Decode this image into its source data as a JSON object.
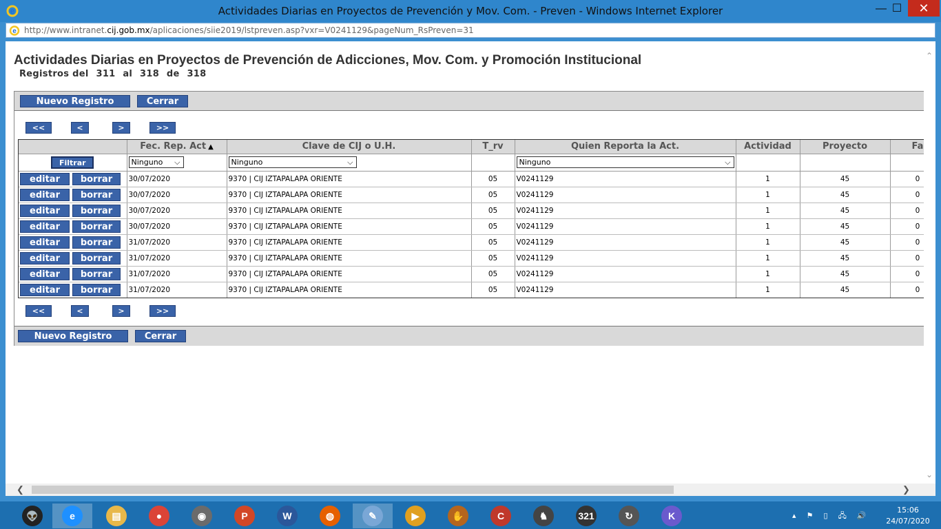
{
  "window": {
    "title": "Actividades Diarias en Proyectos de Prevención y Mov. Com. - Preven - Windows Internet Explorer",
    "minimize": "—",
    "maximize": "☐",
    "close": "✕"
  },
  "address": {
    "url_prefix": "http://www.intranet.",
    "url_domain": "cij.gob.mx",
    "url_suffix": "/aplicaciones/siie2019/lstpreven.asp?vxr=V0241129&pageNum_RsPreven=31"
  },
  "page": {
    "title": "Actividades Diarias en Proyectos de Prevención de Adicciones, Mov. Com. y Promoción Institucional",
    "records": {
      "prefix": "Registros del",
      "from": "311",
      "al": "al",
      "to": "318",
      "de": "de",
      "total": "318"
    }
  },
  "toolbar": {
    "nuevo_label": "Nuevo Registro",
    "cerrar_label": "Cerrar"
  },
  "pager": {
    "first": "<<",
    "prev": "<",
    "next": ">",
    "last": ">>"
  },
  "grid": {
    "columns": [
      {
        "label": ""
      },
      {
        "label": "Fec. Rep. Act"
      },
      {
        "label": "Clave de CIJ o U.H."
      },
      {
        "label": "T_rv"
      },
      {
        "label": "Quien Reporta la Act."
      },
      {
        "label": "Actividad"
      },
      {
        "label": "Proyecto"
      },
      {
        "label": "Fa"
      }
    ],
    "sort_indicator": "▲",
    "filter_label": "Filtrar",
    "filter_options": {
      "fecha": "Ninguno",
      "clave": "Ninguno",
      "quien": "Ninguno"
    },
    "editar_label": "editar",
    "borrar_label": "borrar",
    "rows": [
      {
        "fecha": "30/07/2020",
        "clave": "9370 | CIJ IZTAPALAPA ORIENTE",
        "trv": "05",
        "quien": "V0241129",
        "actividad": "1",
        "proyecto": "45",
        "fa": "0"
      },
      {
        "fecha": "30/07/2020",
        "clave": "9370 | CIJ IZTAPALAPA ORIENTE",
        "trv": "05",
        "quien": "V0241129",
        "actividad": "1",
        "proyecto": "45",
        "fa": "0"
      },
      {
        "fecha": "30/07/2020",
        "clave": "9370 | CIJ IZTAPALAPA ORIENTE",
        "trv": "05",
        "quien": "V0241129",
        "actividad": "1",
        "proyecto": "45",
        "fa": "0"
      },
      {
        "fecha": "30/07/2020",
        "clave": "9370 | CIJ IZTAPALAPA ORIENTE",
        "trv": "05",
        "quien": "V0241129",
        "actividad": "1",
        "proyecto": "45",
        "fa": "0"
      },
      {
        "fecha": "31/07/2020",
        "clave": "9370 | CIJ IZTAPALAPA ORIENTE",
        "trv": "05",
        "quien": "V0241129",
        "actividad": "1",
        "proyecto": "45",
        "fa": "0"
      },
      {
        "fecha": "31/07/2020",
        "clave": "9370 | CIJ IZTAPALAPA ORIENTE",
        "trv": "05",
        "quien": "V0241129",
        "actividad": "1",
        "proyecto": "45",
        "fa": "0"
      },
      {
        "fecha": "31/07/2020",
        "clave": "9370 | CIJ IZTAPALAPA ORIENTE",
        "trv": "05",
        "quien": "V0241129",
        "actividad": "1",
        "proyecto": "45",
        "fa": "0"
      },
      {
        "fecha": "31/07/2020",
        "clave": "9370 | CIJ IZTAPALAPA ORIENTE",
        "trv": "05",
        "quien": "V0241129",
        "actividad": "1",
        "proyecto": "45",
        "fa": "0"
      }
    ]
  },
  "taskbar": {
    "apps": [
      {
        "name": "alien-icon",
        "glyph": "👽",
        "color": "#222222"
      },
      {
        "name": "internet-explorer-icon",
        "glyph": "e",
        "color": "#1e90ff",
        "active": true
      },
      {
        "name": "file-explorer-icon",
        "glyph": "▤",
        "color": "#e8b84a"
      },
      {
        "name": "chrome-icon",
        "glyph": "●",
        "color": "#db4437"
      },
      {
        "name": "media-player-icon",
        "glyph": "◉",
        "color": "#6b6b6b"
      },
      {
        "name": "powerpoint-icon",
        "glyph": "P",
        "color": "#d24726"
      },
      {
        "name": "word-icon",
        "glyph": "W",
        "color": "#2b579a"
      },
      {
        "name": "firefox-icon",
        "glyph": "◍",
        "color": "#e66000"
      },
      {
        "name": "paint-icon",
        "glyph": "✎",
        "color": "#7aa7d6",
        "active": true
      },
      {
        "name": "video-player-icon",
        "glyph": "▶",
        "color": "#e0a020"
      },
      {
        "name": "baseball-glove-icon",
        "glyph": "✋",
        "color": "#b5651d"
      },
      {
        "name": "ccleaner-icon",
        "glyph": "C",
        "color": "#c0392b"
      },
      {
        "name": "chess-icon",
        "glyph": "♞",
        "color": "#444444"
      },
      {
        "name": "calendar-321-icon",
        "glyph": "321",
        "color": "#333333"
      },
      {
        "name": "sync-icon",
        "glyph": "↻",
        "color": "#555555"
      },
      {
        "name": "k-app-icon",
        "glyph": "K",
        "color": "#6a5acd"
      }
    ],
    "tray_icons": "▴  ⚑  ▯  🖧  🔊",
    "time": "15:06",
    "date": "24/07/2020"
  }
}
